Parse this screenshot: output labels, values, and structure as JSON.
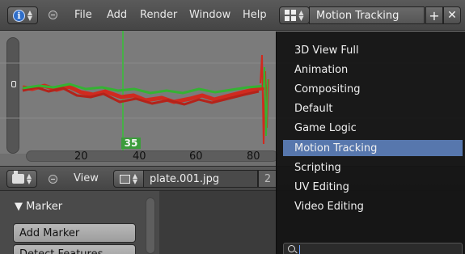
{
  "colors": {
    "graph_bg": "#7b7b7b",
    "curve_red": "#d02a1f",
    "curve_green": "#35b233",
    "frame_indicator": "#3c9c3c",
    "menu_bg": "#141414",
    "menu_highlight": "#5777ad"
  },
  "header": {
    "editor_type_icon": "info-icon",
    "menus": [
      "File",
      "Add",
      "Render",
      "Window",
      "Help"
    ],
    "screen_layout_icon": "layout-grid-icon",
    "screen_layout_value": "Motion Tracking",
    "add_icon": "plus-icon",
    "delete_icon": "close-icon"
  },
  "graph_editor": {
    "current_frame": "35",
    "ruler_ticks": [
      "20",
      "40",
      "60",
      "80"
    ]
  },
  "clip_editor_header": {
    "editor_type_icon": "movie-clip-icon",
    "view_menu": "View",
    "clip_browse_icon": "image-icon",
    "clip_name": "plate.001.jpg",
    "clip_users": "2"
  },
  "tool_panel": {
    "section_title": "Marker",
    "buttons": [
      "Add Marker",
      "Detect Features"
    ]
  },
  "screen_layout_menu": {
    "items": [
      "3D View Full",
      "Animation",
      "Compositing",
      "Default",
      "Game Logic",
      "Motion Tracking",
      "Scripting",
      "UV Editing",
      "Video Editing"
    ],
    "active_index": 5,
    "search_icon": "search-icon"
  }
}
